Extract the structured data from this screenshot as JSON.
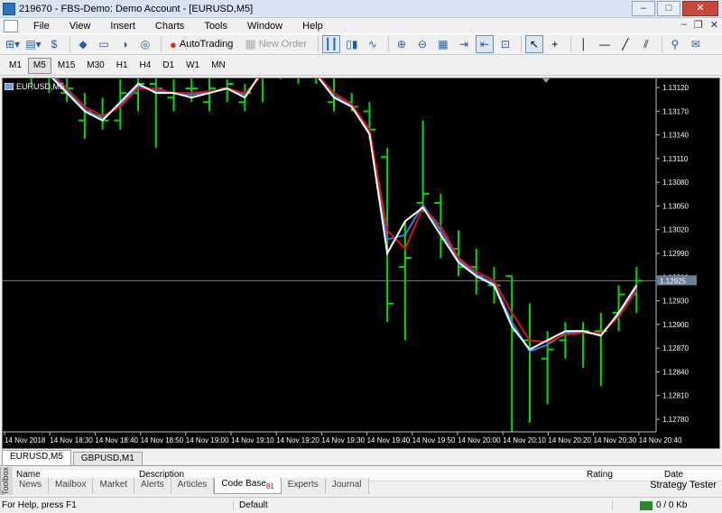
{
  "window": {
    "title": "219670 - FBS-Demo: Demo Account - [EURUSD,M5]"
  },
  "menu": [
    "File",
    "View",
    "Insert",
    "Charts",
    "Tools",
    "Window",
    "Help"
  ],
  "toolbar": {
    "autotrading": "AutoTrading",
    "new_order": "New Order"
  },
  "timeframes": [
    "M1",
    "M5",
    "M15",
    "M30",
    "H1",
    "H4",
    "D1",
    "W1",
    "MN"
  ],
  "active_timeframe": "M5",
  "chart": {
    "tab_label": "EURUSD,M5",
    "current_price_label": "1.12925",
    "price_ticks": [
      "1.13120",
      "1.13170",
      "1.13140",
      "1.13110",
      "1.13080",
      "1.13050",
      "1.13020",
      "1.12990",
      "1.12960",
      "1.12930",
      "1.12900",
      "1.12870",
      "1.12840",
      "1.12810",
      "1.12780"
    ],
    "time_ticks": [
      "14 Nov 2018",
      "14 Nov 18:30",
      "14 Nov 18:40",
      "14 Nov 18:50",
      "14 Nov 19:00",
      "14 Nov 19:10",
      "14 Nov 19:20",
      "14 Nov 19:30",
      "14 Nov 19:40",
      "14 Nov 19:50",
      "14 Nov 20:00",
      "14 Nov 20:10",
      "14 Nov 20:20",
      "14 Nov 20:30",
      "14 Nov 20:40"
    ],
    "colors": {
      "background": "#000000",
      "bars": "#00dd00",
      "ma_white": "#ffffff",
      "ma_red": "#e01010",
      "ma_blue": "#3a7ae0",
      "axis_text": "#ffffff"
    }
  },
  "chart_data": {
    "type": "line",
    "title": "EURUSD,M5",
    "ylim": [
      1.1276,
      1.1314
    ],
    "ohlc": [
      {
        "o": 1.13165,
        "h": 1.13165,
        "l": 1.1315,
        "c": 1.1316
      },
      {
        "o": 1.13155,
        "h": 1.13175,
        "l": 1.1314,
        "c": 1.1317
      },
      {
        "o": 1.1316,
        "h": 1.13165,
        "l": 1.1313,
        "c": 1.1315
      },
      {
        "o": 1.1313,
        "h": 1.1316,
        "l": 1.1312,
        "c": 1.13135
      },
      {
        "o": 1.131,
        "h": 1.1313,
        "l": 1.1308,
        "c": 1.1311
      },
      {
        "o": 1.13105,
        "h": 1.13125,
        "l": 1.1309,
        "c": 1.131
      },
      {
        "o": 1.131,
        "h": 1.13145,
        "l": 1.1309,
        "c": 1.1313
      },
      {
        "o": 1.1313,
        "h": 1.1315,
        "l": 1.1311,
        "c": 1.1314
      },
      {
        "o": 1.1314,
        "h": 1.1315,
        "l": 1.1307,
        "c": 1.13135
      },
      {
        "o": 1.13125,
        "h": 1.13145,
        "l": 1.1311,
        "c": 1.1313
      },
      {
        "o": 1.13135,
        "h": 1.1315,
        "l": 1.1312,
        "c": 1.13135
      },
      {
        "o": 1.1312,
        "h": 1.1315,
        "l": 1.1311,
        "c": 1.13135
      },
      {
        "o": 1.13135,
        "h": 1.13145,
        "l": 1.1312,
        "c": 1.1314
      },
      {
        "o": 1.1312,
        "h": 1.1314,
        "l": 1.1311,
        "c": 1.1313
      },
      {
        "o": 1.13165,
        "h": 1.1318,
        "l": 1.1312,
        "c": 1.1316
      },
      {
        "o": 1.13165,
        "h": 1.13175,
        "l": 1.13145,
        "c": 1.1316
      },
      {
        "o": 1.1316,
        "h": 1.1317,
        "l": 1.1314,
        "c": 1.1316
      },
      {
        "o": 1.1315,
        "h": 1.13165,
        "l": 1.1314,
        "c": 1.13155
      },
      {
        "o": 1.1312,
        "h": 1.1315,
        "l": 1.1311,
        "c": 1.13125
      },
      {
        "o": 1.1312,
        "h": 1.1313,
        "l": 1.1311,
        "c": 1.13115
      },
      {
        "o": 1.1311,
        "h": 1.1312,
        "l": 1.1308,
        "c": 1.1309
      },
      {
        "o": 1.1306,
        "h": 1.1307,
        "l": 1.1288,
        "c": 1.129
      },
      {
        "o": 1.1294,
        "h": 1.1299,
        "l": 1.1286,
        "c": 1.1295
      },
      {
        "o": 1.1301,
        "h": 1.131,
        "l": 1.13,
        "c": 1.1302
      },
      {
        "o": 1.1301,
        "h": 1.1302,
        "l": 1.1295,
        "c": 1.1297
      },
      {
        "o": 1.1296,
        "h": 1.1298,
        "l": 1.1293,
        "c": 1.1294
      },
      {
        "o": 1.1294,
        "h": 1.1296,
        "l": 1.1291,
        "c": 1.1293
      },
      {
        "o": 1.1292,
        "h": 1.1294,
        "l": 1.129,
        "c": 1.1292
      },
      {
        "o": 1.1293,
        "h": 1.1293,
        "l": 1.1276,
        "c": 1.1287
      },
      {
        "o": 1.1286,
        "h": 1.129,
        "l": 1.1277,
        "c": 1.1285
      },
      {
        "o": 1.1284,
        "h": 1.1287,
        "l": 1.1279,
        "c": 1.1285
      },
      {
        "o": 1.1286,
        "h": 1.1288,
        "l": 1.1284,
        "c": 1.1287
      },
      {
        "o": 1.1287,
        "h": 1.1288,
        "l": 1.1283,
        "c": 1.1287
      },
      {
        "o": 1.1287,
        "h": 1.1289,
        "l": 1.1281,
        "c": 1.1287
      },
      {
        "o": 1.1289,
        "h": 1.1292,
        "l": 1.1287,
        "c": 1.1291
      },
      {
        "o": 1.1291,
        "h": 1.1294,
        "l": 1.1289,
        "c": 1.12925
      }
    ],
    "series": [
      {
        "name": "",
        "color": "#ffffff",
        "values": [
          1.1316,
          1.13165,
          1.1315,
          1.1313,
          1.1311,
          1.131,
          1.1312,
          1.1314,
          1.1313,
          1.1313,
          1.13125,
          1.1313,
          1.13135,
          1.13125,
          1.13155,
          1.1316,
          1.13155,
          1.1315,
          1.13125,
          1.13115,
          1.13085,
          1.12955,
          1.1299,
          1.13005,
          1.12975,
          1.12945,
          1.1293,
          1.1292,
          1.12875,
          1.1285,
          1.1286,
          1.1287,
          1.1287,
          1.12865,
          1.1289,
          1.1292
        ]
      },
      {
        "name": "",
        "color": "#e01010",
        "values": [
          1.1316,
          1.13162,
          1.13155,
          1.13135,
          1.13115,
          1.13105,
          1.13115,
          1.13135,
          1.13135,
          1.1313,
          1.1313,
          1.13132,
          1.13135,
          1.1313,
          1.1315,
          1.13158,
          1.13157,
          1.13152,
          1.1313,
          1.13118,
          1.1309,
          1.1298,
          1.1296,
          1.13005,
          1.12985,
          1.1295,
          1.12935,
          1.12925,
          1.1289,
          1.1286,
          1.12858,
          1.12866,
          1.12868,
          1.12868,
          1.12885,
          1.12915
        ]
      },
      {
        "name": "",
        "color": "#3a7ae0",
        "values": [
          1.1316,
          1.13163,
          1.13152,
          1.13132,
          1.13112,
          1.13102,
          1.13117,
          1.13138,
          1.13132,
          1.1313,
          1.13128,
          1.13131,
          1.13135,
          1.13128,
          1.13152,
          1.1316,
          1.13156,
          1.13151,
          1.13127,
          1.13116,
          1.13087,
          1.1297,
          1.12975,
          1.13008,
          1.1298,
          1.12948,
          1.12932,
          1.12922,
          1.1288,
          1.12848,
          1.12855,
          1.12868,
          1.12869,
          1.12866,
          1.12888,
          1.12918
        ]
      }
    ]
  },
  "symbol_tabs": [
    "EURUSD,M5",
    "GBPUSD,M1"
  ],
  "terminal": {
    "side_label": "Toolbox",
    "columns": [
      "Name",
      "Description",
      "Rating",
      "Date"
    ],
    "tabs": [
      "News",
      "Mailbox",
      "Market",
      "Alerts",
      "Articles",
      "Code Base",
      "Experts",
      "Journal"
    ],
    "active_tab": "Code Base",
    "code_base_badge": "81",
    "tester_label": "Strategy Tester"
  },
  "status": {
    "help": "For Help, press F1",
    "profile": "Default",
    "traffic": "0 / 0 Kb"
  }
}
